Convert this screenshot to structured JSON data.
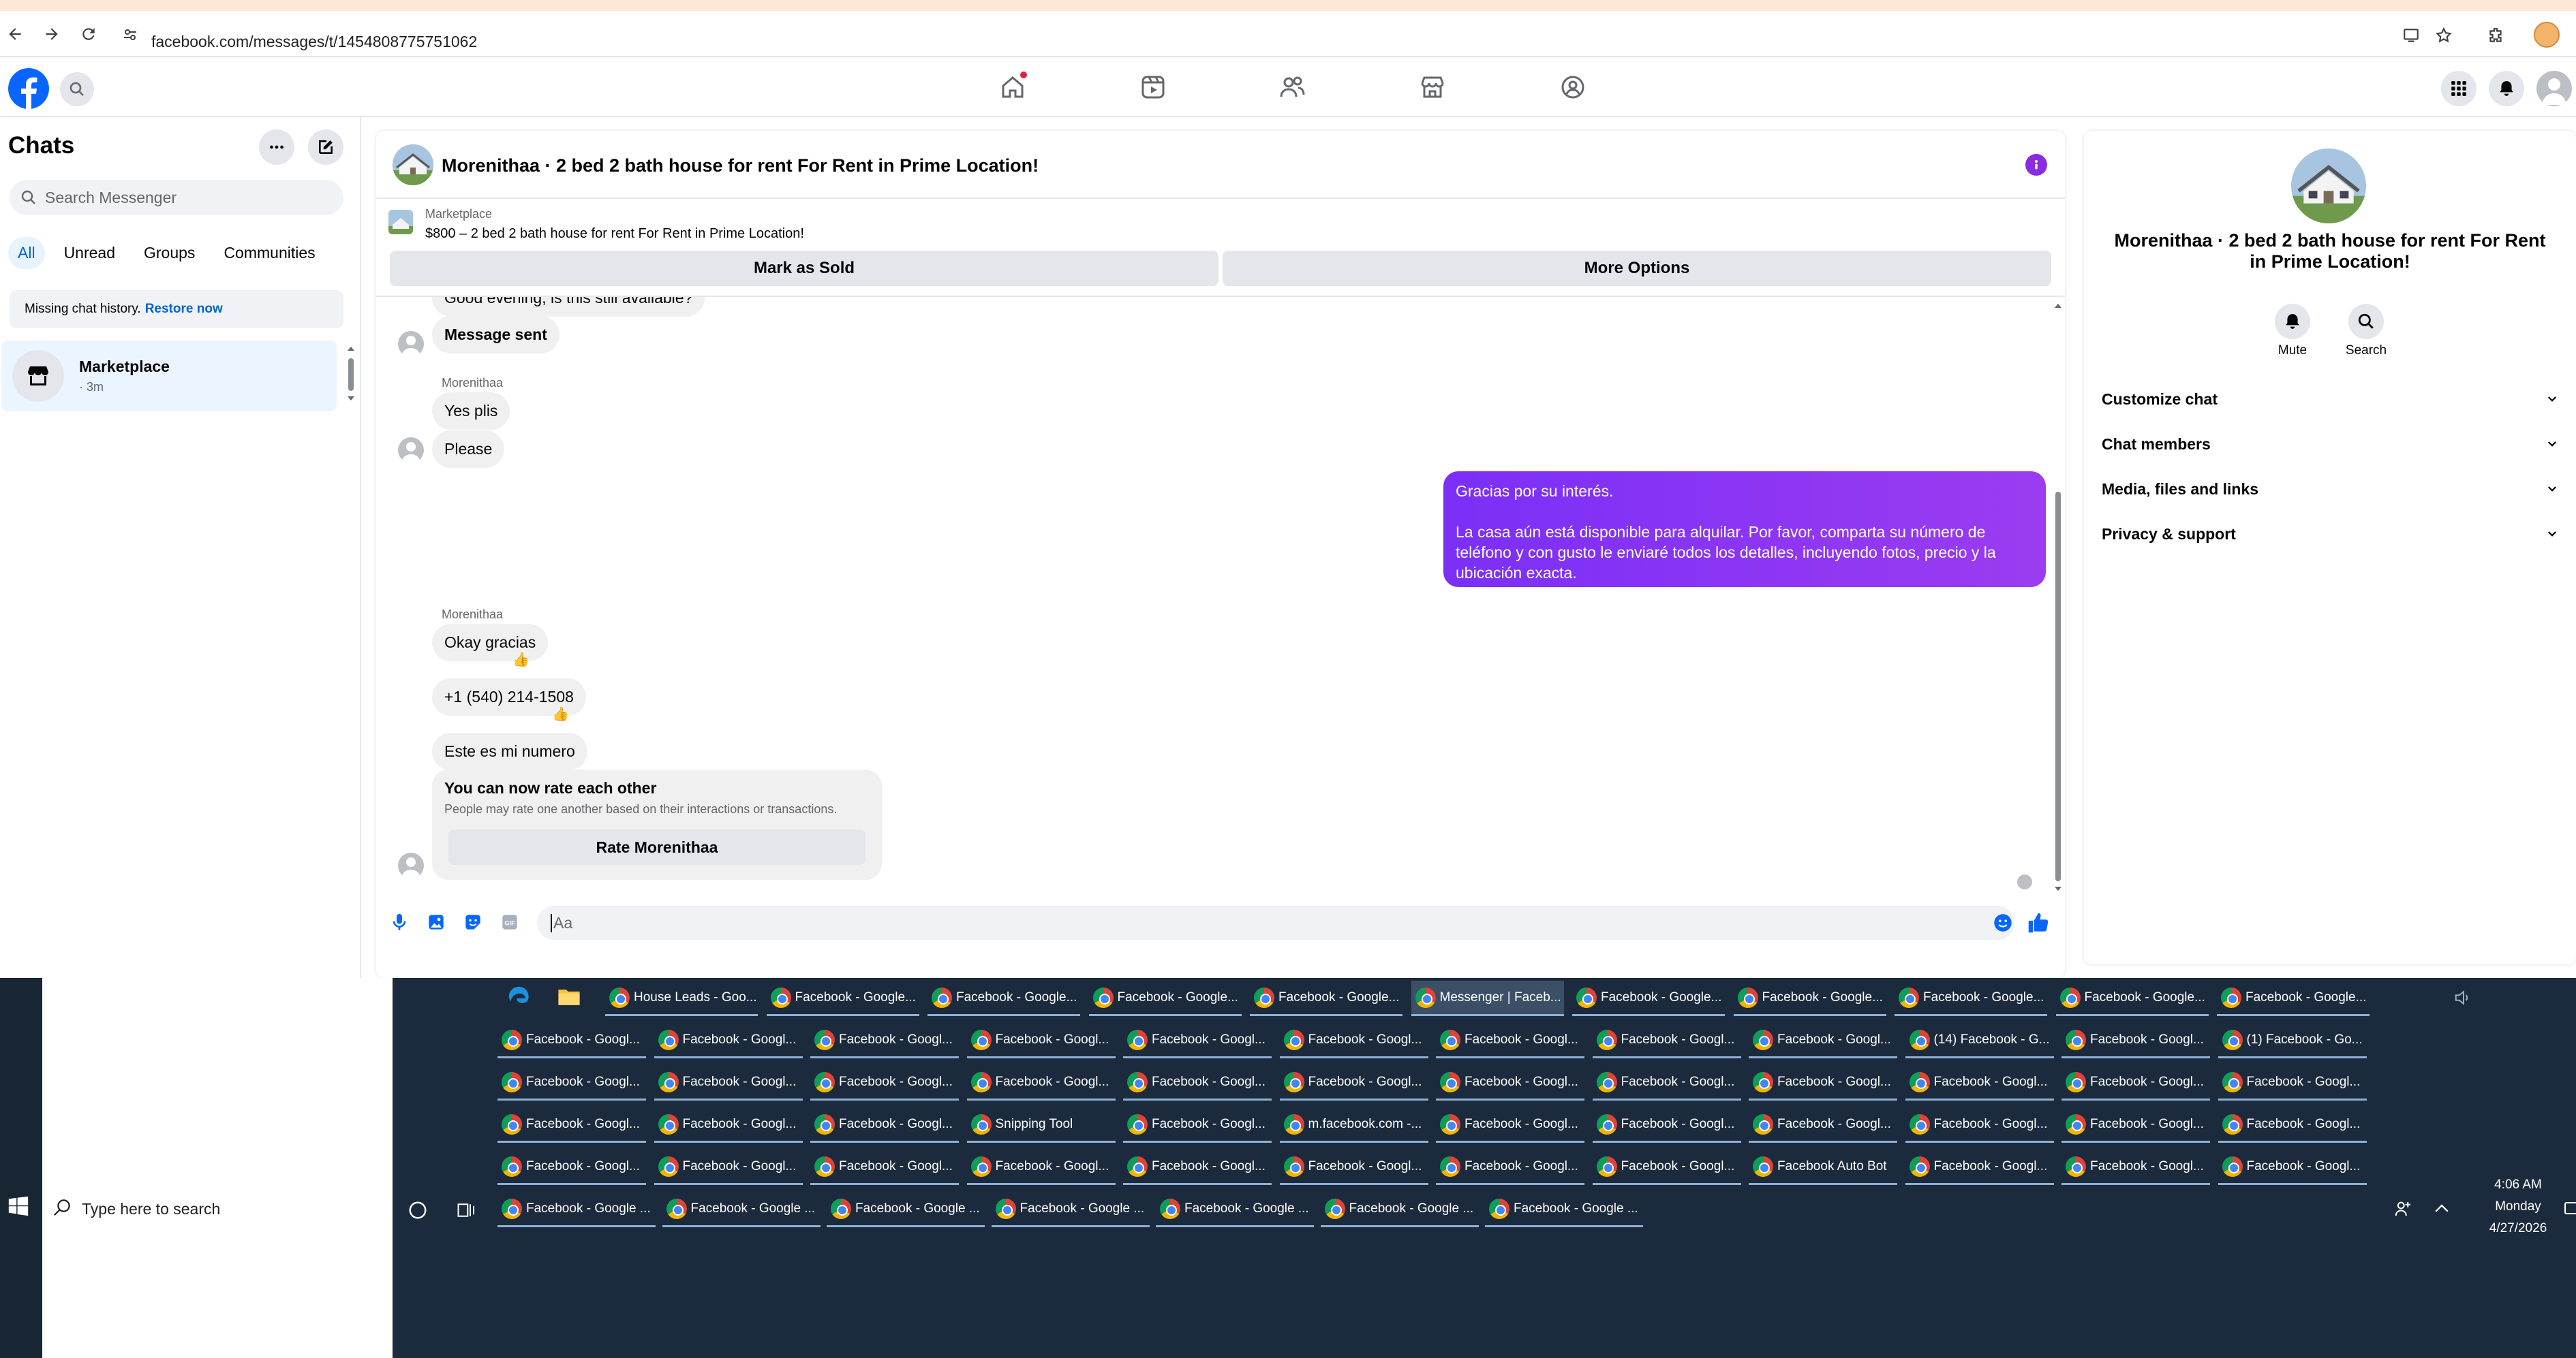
{
  "browser": {
    "url": "facebook.com/messages/t/1454808775751062"
  },
  "sidebar": {
    "title": "Chats",
    "search_placeholder": "Search Messenger",
    "tabs": [
      {
        "label": "All"
      },
      {
        "label": "Unread"
      },
      {
        "label": "Groups"
      },
      {
        "label": "Communities"
      }
    ],
    "missing_text": "Missing chat history.",
    "restore_label": "Restore now",
    "chat_item": {
      "name": "Marketplace",
      "time": "· 3m"
    }
  },
  "chat": {
    "title": "Morenithaa · 2 bed 2 bath house for rent For Rent in Prime Location!",
    "listing_label": "Marketplace",
    "listing_detail": "$800 – 2 bed 2 bath house for rent For Rent in Prime Location!",
    "mark_sold": "Mark as Sold",
    "more_options": "More Options",
    "messages": {
      "partial": "Good evening, is this still available?",
      "sent_note": "Message sent",
      "sender1": "Morenithaa",
      "m1": "Yes plis",
      "m2": "Please",
      "out_line1": "Gracias por su interés.",
      "out_line2": "La casa aún está disponible para alquilar. Por favor, comparta su número de teléfono y con gusto le enviaré todos los detalles, incluyendo fotos, precio y la ubicación exacta.",
      "sender2": "Morenithaa",
      "m3": "Okay gracias",
      "m4": "+1 (540) 214-1508",
      "m5": "Este es mi numero",
      "reaction": "👍"
    },
    "rate": {
      "title": "You can now rate each other",
      "subtitle": "People may rate one another based on their interactions or transactions.",
      "button": "Rate Morenithaa"
    },
    "composer_placeholder": "Aa"
  },
  "right_panel": {
    "title": "Morenithaa · 2 bed 2 bath house for rent For Rent in Prime Location!",
    "mute": "Mute",
    "search": "Search",
    "sections": [
      {
        "label": "Customize chat"
      },
      {
        "label": "Chat members"
      },
      {
        "label": "Media, files and links"
      },
      {
        "label": "Privacy & support"
      }
    ]
  },
  "taskbar": {
    "search_placeholder": "Type here to search",
    "time": "4:06 AM",
    "day": "Monday",
    "date": "4/27/2026",
    "rows": [
      [
        "House Leads - Goo...",
        "Facebook - Google...",
        "Facebook - Google...",
        "Facebook - Google...",
        "Facebook - Google...",
        "Messenger | Faceb...",
        "Facebook - Google...",
        "Facebook - Google...",
        "Facebook - Google...",
        "Facebook - Google...",
        "Facebook - Google..."
      ],
      [
        "Facebook - Googl...",
        "Facebook - Googl...",
        "Facebook - Googl...",
        "Facebook - Googl...",
        "Facebook - Googl...",
        "Facebook - Googl...",
        "Facebook - Googl...",
        "Facebook - Googl...",
        "Facebook - Googl...",
        "(14) Facebook - G...",
        "Facebook - Googl...",
        "(1) Facebook - Go..."
      ],
      [
        "Facebook - Googl...",
        "Facebook - Googl...",
        "Facebook - Googl...",
        "Facebook - Googl...",
        "Facebook - Googl...",
        "Facebook - Googl...",
        "Facebook - Googl...",
        "Facebook - Googl...",
        "Facebook - Googl...",
        "Facebook - Googl...",
        "Facebook - Googl...",
        "Facebook - Googl..."
      ],
      [
        "Facebook - Googl...",
        "Facebook - Googl...",
        "Facebook - Googl...",
        "Snipping Tool",
        "Facebook - Googl...",
        "m.facebook.com -...",
        "Facebook - Googl...",
        "Facebook - Googl...",
        "Facebook - Googl...",
        "Facebook - Googl...",
        "Facebook - Googl...",
        "Facebook - Googl..."
      ],
      [
        "Facebook - Googl...",
        "Facebook - Googl...",
        "Facebook - Googl...",
        "Facebook - Googl...",
        "Facebook - Googl...",
        "Facebook - Googl...",
        "Facebook - Googl...",
        "Facebook - Googl...",
        "Facebook Auto Bot",
        "Facebook - Googl...",
        "Facebook - Googl...",
        "Facebook - Googl..."
      ],
      [
        "Facebook - Google ...",
        "Facebook - Google ...",
        "Facebook - Google ...",
        "Facebook - Google ...",
        "Facebook - Google ...",
        "Facebook - Google ...",
        "Facebook - Google ..."
      ]
    ]
  },
  "colors": {
    "fb_blue": "#0866ff",
    "purple": "#7b2ff7",
    "taskbar": "#1b2b3d"
  }
}
